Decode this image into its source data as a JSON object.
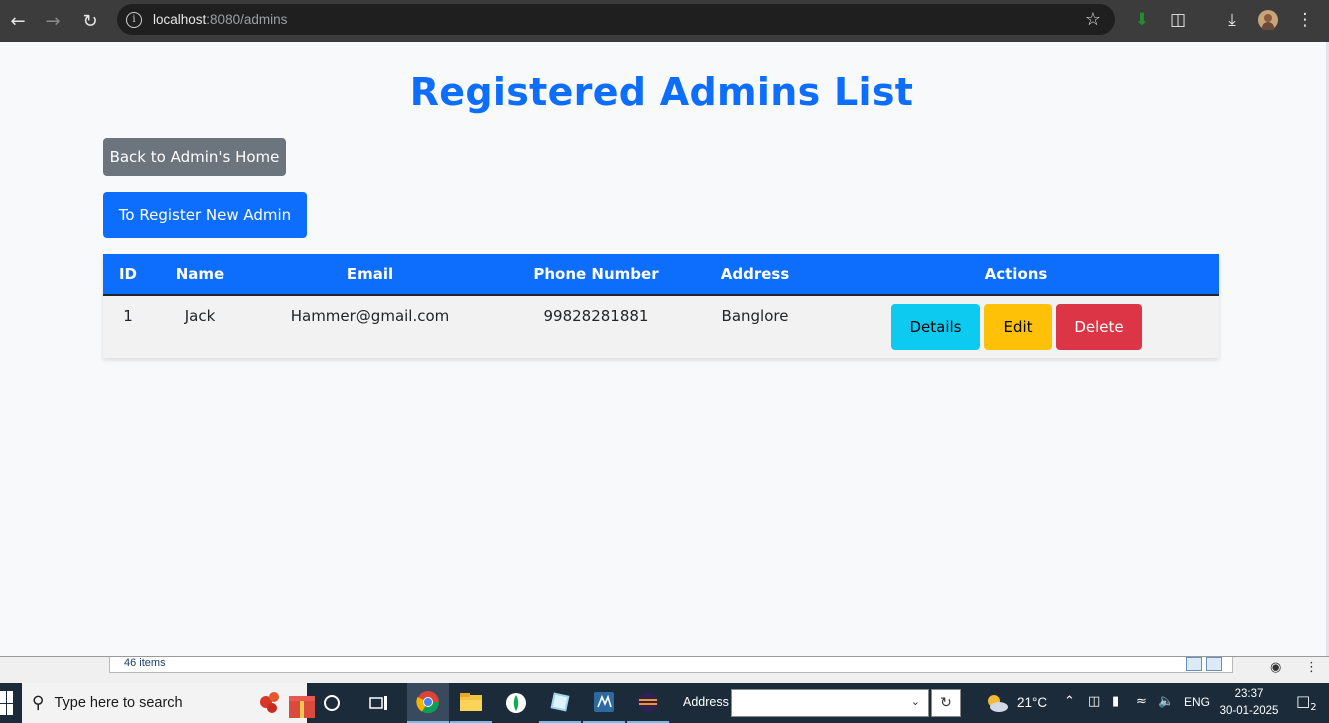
{
  "browser": {
    "url_host": "localhost",
    "url_path": ":8080/admins"
  },
  "page": {
    "title": "Registered Admins List",
    "back_button": "Back to Admin's Home",
    "register_button": "To Register New Admin"
  },
  "table": {
    "headers": [
      "ID",
      "Name",
      "Email",
      "Phone Number",
      "Address",
      "Actions"
    ],
    "rows": [
      {
        "id": "1",
        "name": "Jack",
        "email": "Hammer@gmail.com",
        "phone": "99828281881",
        "address": "Banglore"
      }
    ],
    "actions": {
      "details": "Details",
      "edit": "Edit",
      "delete": "Delete"
    }
  },
  "explorer": {
    "items_count": "46 items"
  },
  "taskbar": {
    "search_placeholder": "Type here to search",
    "address_label": "Address",
    "temperature": "21°C",
    "language": "ENG",
    "time": "23:37",
    "date": "30-01-2025",
    "notification_count": "2"
  },
  "colors": {
    "primary": "#0d6efd",
    "secondary": "#6c757d",
    "info": "#0dcaf0",
    "warning": "#ffc107",
    "danger": "#dc3545"
  }
}
